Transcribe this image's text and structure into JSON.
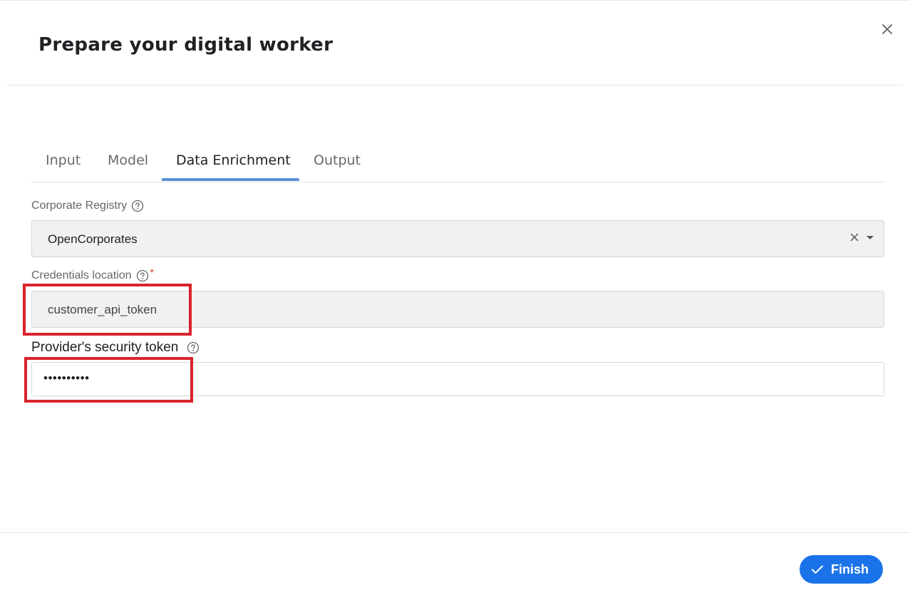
{
  "dialog": {
    "title": "Prepare your digital worker",
    "close_icon": "close-icon"
  },
  "tabs": [
    {
      "label": "Input",
      "active": false
    },
    {
      "label": "Model",
      "active": false
    },
    {
      "label": "Data Enrichment",
      "active": true
    },
    {
      "label": "Output",
      "active": false
    }
  ],
  "form": {
    "corporate_registry": {
      "label": "Corporate Registry",
      "value": "OpenCorporates",
      "help_icon": "help-circle-icon"
    },
    "credentials_location": {
      "label": "Credentials location",
      "required_mark": "*",
      "value": "customer_api_token",
      "help_icon": "help-circle-icon"
    },
    "security_token": {
      "label": "Provider's security token",
      "value": "••••••••••",
      "help_icon": "help-circle-icon"
    }
  },
  "footer": {
    "finish_label": "Finish",
    "finish_icon": "check-icon"
  },
  "colors": {
    "accent": "#1a73e8",
    "tab_underline": "#5b8fd6",
    "highlight": "#d9232d",
    "required": "#d93025"
  }
}
